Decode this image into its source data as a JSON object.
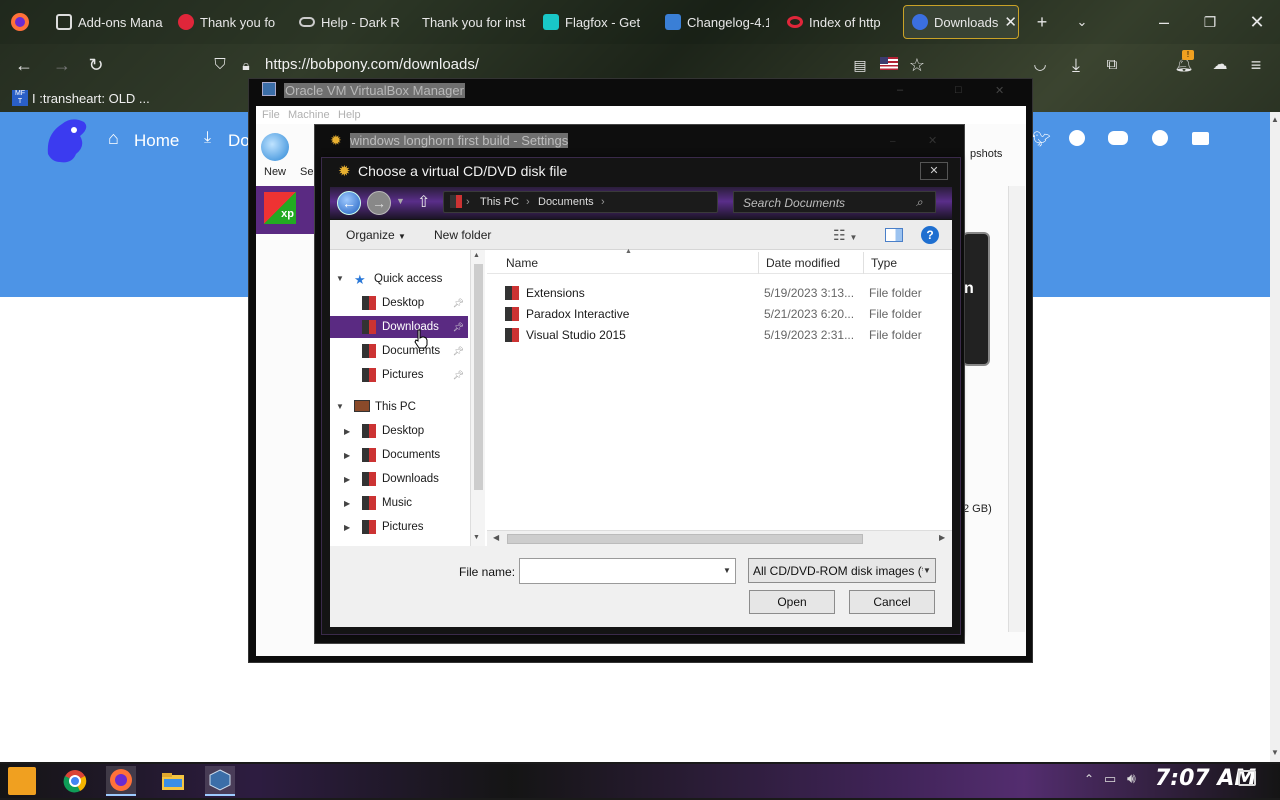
{
  "browser": {
    "tabs": [
      {
        "label": "Add-ons Mana",
        "icon": "puzzle-icon"
      },
      {
        "label": "Thank you fo",
        "icon": "lock-icon"
      },
      {
        "label": "Help - Dark R",
        "icon": "glasses-icon"
      },
      {
        "label": "Thank you for inst",
        "icon": "none"
      },
      {
        "label": "Flagfox - Get",
        "icon": "fox-icon"
      },
      {
        "label": "Changelog-4.1",
        "icon": "image-icon"
      },
      {
        "label": "Index of http",
        "icon": "ring-icon"
      },
      {
        "label": "Downloads",
        "icon": "bobpony-icon",
        "active": true
      }
    ],
    "url": "https://bobpony.com/downloads/",
    "bookmark_label": "I :transheart: OLD ...",
    "notification_badge": "!",
    "accent": "#c9a227"
  },
  "site": {
    "nav_home": "Home",
    "nav_downloads": "Do",
    "snapshots_fragment": "pshots",
    "size_fragment": "2 GB)",
    "n_fragment": "n",
    "hero_color": "#4d94e6"
  },
  "vbox": {
    "title": "Oracle VM VirtualBox Manager",
    "menu": [
      "File",
      "Machine",
      "Help"
    ],
    "tool_new": "New",
    "tool_settings": "Se",
    "vm_badge": "xp"
  },
  "settings": {
    "title": "windows longhorn first build - Settings"
  },
  "file_dialog": {
    "title": "Choose a virtual CD/DVD disk file",
    "breadcrumb": [
      "This PC",
      "Documents"
    ],
    "search_placeholder": "Search Documents",
    "toolbar": {
      "organize": "Organize",
      "new_folder": "New folder",
      "help": "?"
    },
    "nav": {
      "quick_access": "Quick access",
      "quick_items": [
        "Desktop",
        "Downloads",
        "Documents",
        "Pictures"
      ],
      "this_pc": "This PC",
      "pc_items": [
        "Desktop",
        "Documents",
        "Downloads",
        "Music",
        "Pictures"
      ]
    },
    "selected_nav": "Downloads",
    "columns": [
      "Name",
      "Date modified",
      "Type"
    ],
    "files": [
      {
        "name": "Extensions",
        "date": "5/19/2023 3:13...",
        "type": "File folder"
      },
      {
        "name": "Paradox Interactive",
        "date": "5/21/2023 6:20...",
        "type": "File folder"
      },
      {
        "name": "Visual Studio 2015",
        "date": "5/19/2023 2:31...",
        "type": "File folder"
      }
    ],
    "file_name_label": "File name:",
    "file_name_value": "",
    "filter": "All CD/DVD-ROM disk images (*",
    "open": "Open",
    "cancel": "Cancel",
    "accent": "#5a2a82"
  },
  "taskbar": {
    "clock": "7:07 AM"
  }
}
